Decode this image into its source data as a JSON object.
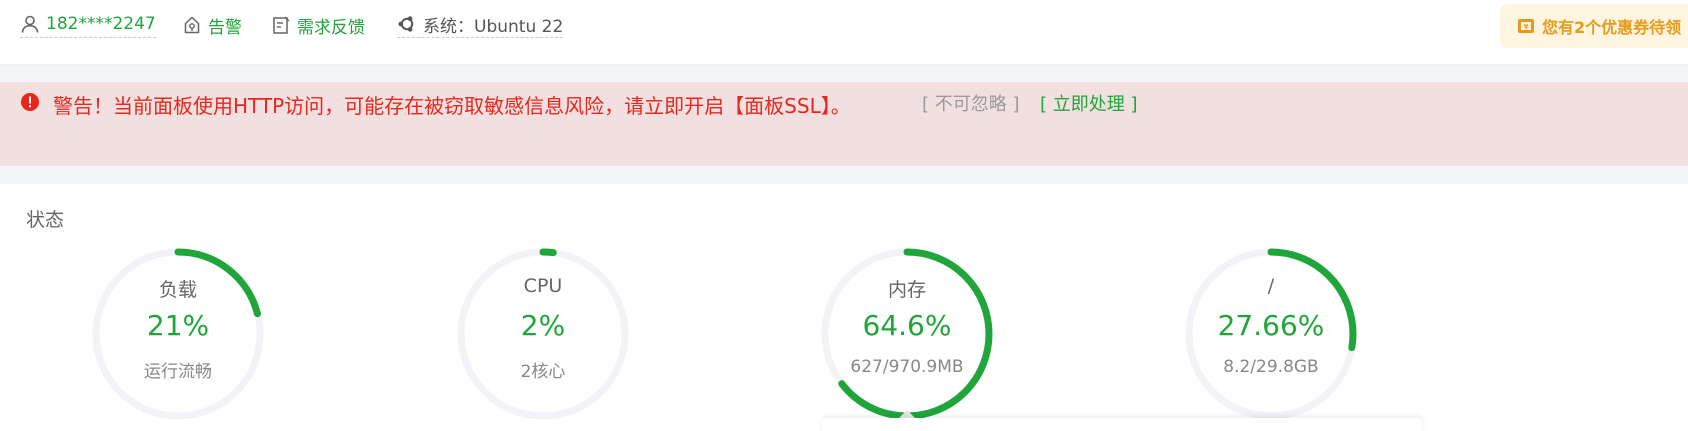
{
  "topbar": {
    "user": "182****2247",
    "alarm": "告警",
    "feedback": "需求反馈",
    "os": "系统：Ubuntu 22",
    "coupon": "您有2个优惠券待领"
  },
  "alert": {
    "text": "警告！当前面板使用HTTP访问，可能存在被窃取敏感信息风险，请立即开启【面板SSL】。",
    "ignore": "[ 不可忽略 ]",
    "handle": "[ 立即处理 ]"
  },
  "status": {
    "title": "状态",
    "gauges": [
      {
        "label": "负载",
        "value": "21%",
        "sub": "运行流畅",
        "fraction": 0.21
      },
      {
        "label": "CPU",
        "value": "2%",
        "sub": "2核心",
        "fraction": 0.02
      },
      {
        "label": "内存",
        "value": "64.6%",
        "sub": "627/970.9MB",
        "fraction": 0.646
      },
      {
        "label": "/",
        "value": "27.66%",
        "sub": "8.2/29.8GB",
        "fraction": 0.2766
      }
    ]
  },
  "colors": {
    "accent": "#20a53a",
    "warning": "#e8271c",
    "track": "#f2f3f7",
    "coupon": "#e79b1b"
  }
}
